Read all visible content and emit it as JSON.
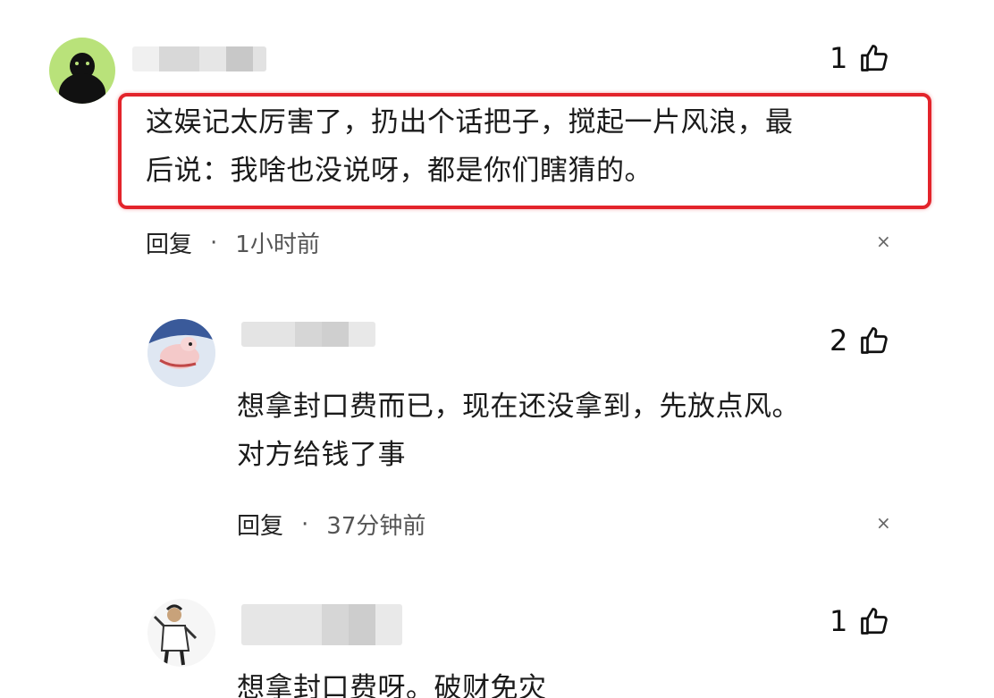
{
  "comments": [
    {
      "likes": "1",
      "text_lines": [
        "这娱记太厉害了，扔出个话把子，搅起一片风浪，最",
        "后说：我啥也没说呀，都是你们瞎猜的。"
      ],
      "reply_label": "回复",
      "separator": "·",
      "time": "1小时前",
      "close": "×"
    },
    {
      "likes": "2",
      "text_lines": [
        "想拿封口费而已，现在还没拿到，先放点风。",
        "对方给钱了事"
      ],
      "reply_label": "回复",
      "separator": "·",
      "time": "37分钟前",
      "close": "×"
    },
    {
      "likes": "1",
      "text_lines": [
        "想拿封口费呀。破财免灾"
      ]
    }
  ],
  "colors": {
    "highlight": "#e3242b",
    "avatar1_bg": "#b9e27a"
  },
  "icons": {
    "like": "thumbs-up-icon",
    "close": "close-icon"
  }
}
